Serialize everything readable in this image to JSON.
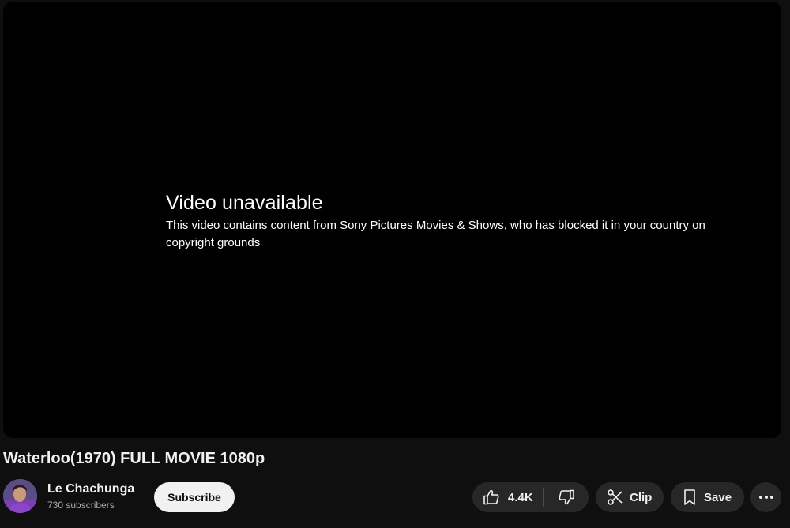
{
  "player": {
    "error_title": "Video unavailable",
    "error_detail": "This video contains content from Sony Pictures Movies & Shows, who has blocked it in your country on copyright grounds"
  },
  "video": {
    "title": "Waterloo(1970) FULL MOVIE 1080p"
  },
  "channel": {
    "name": "Le Chachunga",
    "subscribers": "730 subscribers",
    "subscribe_label": "Subscribe"
  },
  "actions": {
    "like_count": "4.4K",
    "clip_label": "Clip",
    "save_label": "Save"
  },
  "icons": {
    "like": "thumbs-up-icon",
    "dislike": "thumbs-down-icon",
    "clip": "scissors-icon",
    "save": "bookmark-icon",
    "more": "more-horizontal-icon"
  },
  "colors": {
    "page_bg": "#0f0f0f",
    "player_bg": "#000000",
    "button_bg": "#272727",
    "subscribe_bg": "#f1f1f1",
    "text_primary": "#f1f1f1",
    "text_secondary": "#aaaaaa"
  }
}
